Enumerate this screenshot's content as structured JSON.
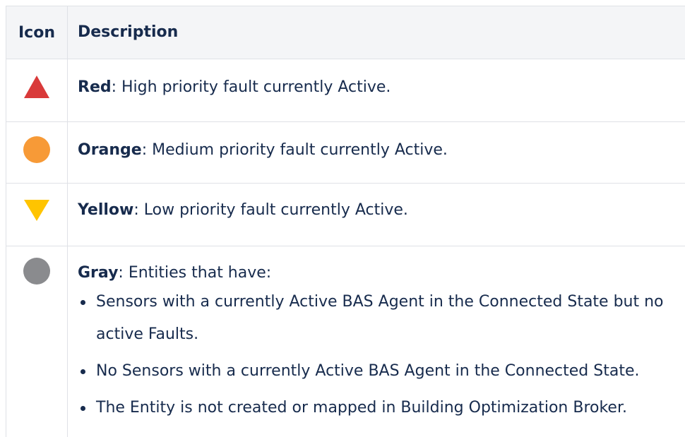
{
  "table": {
    "headers": {
      "icon": "Icon",
      "description": "Description"
    },
    "rows": [
      {
        "icon": "red-triangle-up-icon",
        "color": "#d93a3a",
        "name": "Red",
        "text": ": High priority fault currently Active."
      },
      {
        "icon": "orange-circle-icon",
        "color": "#f79a37",
        "name": "Orange",
        "text": ": Medium priority fault currently Active."
      },
      {
        "icon": "yellow-triangle-down-icon",
        "color": "#ffc400",
        "name": "Yellow",
        "text": ": Low priority fault currently Active."
      },
      {
        "icon": "gray-circle-icon",
        "color": "#8a8b8e",
        "name": "Gray",
        "text": ": Entities that have:",
        "bullets": [
          "Sensors with a currently Active BAS Agent in the Connected State but no active Faults.",
          "No Sensors with a currently Active BAS Agent in the Connected State.",
          "The Entity is not created or mapped in Building Optimization Broker."
        ]
      }
    ]
  }
}
